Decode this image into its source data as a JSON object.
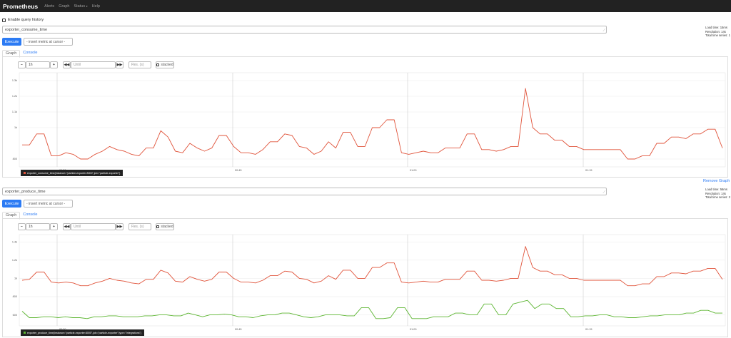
{
  "navbar": {
    "brand": "Prometheus",
    "items": [
      "Alerts",
      "Graph",
      "Status",
      "Help"
    ]
  },
  "history": {
    "label": "Enable query history"
  },
  "panels": [
    {
      "expression": "exporter_consume_time",
      "stats": {
        "load_time": "Load time: 15ms",
        "resolution": "Resolution: 14s",
        "series": "Total time series: 1"
      },
      "execute_label": "Execute",
      "insert_metric": "- insert metric at cursor -",
      "tabs": [
        "Graph",
        "Console"
      ],
      "controls": {
        "minus": "−",
        "range": "1h",
        "plus": "+",
        "back": "◀◀",
        "until_placeholder": "Until",
        "forward": "▶▶",
        "res_placeholder": "Res. (s)",
        "stacked": "stacked"
      },
      "legend": [
        "exporter_consume_time{instance=\"particle-exporter:8000\",job=\"particle-exporter\"}"
      ],
      "remove_label": "Remove Graph"
    },
    {
      "expression": "exporter_produce_time",
      "stats": {
        "load_time": "Load time: 56ms",
        "resolution": "Resolution: 14s",
        "series": "Total time series: 2"
      },
      "execute_label": "Execute",
      "insert_metric": "- insert metric at cursor -",
      "tabs": [
        "Graph",
        "Console"
      ],
      "controls": {
        "minus": "−",
        "range": "1h",
        "plus": "+",
        "back": "◀◀",
        "until_placeholder": "Until",
        "forward": "▶▶",
        "res_placeholder": "Res. (s)",
        "stacked": "stacked"
      },
      "legend": [
        "exporter_produce_time{instance=\"particle-exporter:8000\",job=\"particle-exporter\",type=\"Integrations\"}"
      ]
    }
  ],
  "chart_data": [
    {
      "type": "line",
      "y_ticks": [
        "800",
        "1k",
        "1.1k",
        "1.2k",
        "1.3k"
      ],
      "x_ticks": [
        "00:30",
        "00:45",
        "01:00",
        "01:15"
      ],
      "ylim": [
        750,
        1350
      ],
      "grid": true,
      "series": [
        {
          "color": "#e0533a",
          "values": [
            890,
            890,
            960,
            960,
            820,
            820,
            840,
            830,
            800,
            800,
            830,
            850,
            880,
            860,
            850,
            830,
            820,
            870,
            870,
            980,
            940,
            850,
            840,
            900,
            870,
            850,
            870,
            950,
            950,
            880,
            840,
            840,
            830,
            860,
            910,
            910,
            960,
            950,
            880,
            870,
            830,
            850,
            910,
            870,
            970,
            970,
            880,
            880,
            1000,
            1000,
            1050,
            1050,
            840,
            830,
            840,
            850,
            840,
            840,
            870,
            870,
            870,
            960,
            960,
            860,
            860,
            850,
            860,
            880,
            880,
            1250,
            1000,
            960,
            960,
            920,
            920,
            880,
            880,
            860,
            860,
            860,
            860,
            860,
            860,
            800,
            800,
            820,
            820,
            900,
            900,
            940,
            940,
            930,
            960,
            960,
            990,
            990,
            870
          ]
        }
      ]
    },
    {
      "type": "line",
      "y_ticks": [
        "600",
        "800",
        "1k",
        "1.2k",
        "1.4k"
      ],
      "x_ticks": [
        "00:30",
        "00:45",
        "01:00",
        "01:15"
      ],
      "ylim": [
        480,
        1480
      ],
      "grid": true,
      "series": [
        {
          "color": "#e0533a",
          "values": [
            980,
            990,
            1070,
            1070,
            960,
            950,
            960,
            950,
            920,
            920,
            950,
            970,
            1000,
            980,
            970,
            950,
            940,
            990,
            990,
            1090,
            1060,
            970,
            960,
            1020,
            990,
            970,
            990,
            1070,
            1070,
            1000,
            960,
            960,
            950,
            980,
            1030,
            1030,
            1080,
            1070,
            1000,
            990,
            950,
            970,
            1030,
            990,
            1090,
            1090,
            1000,
            1000,
            1120,
            1120,
            1170,
            1170,
            960,
            950,
            960,
            970,
            960,
            960,
            990,
            990,
            990,
            1080,
            1080,
            980,
            980,
            970,
            980,
            1000,
            1000,
            1350,
            1120,
            1080,
            1080,
            1040,
            1040,
            1000,
            1000,
            980,
            980,
            980,
            980,
            980,
            980,
            920,
            920,
            940,
            940,
            1020,
            1020,
            1060,
            1060,
            1050,
            1080,
            1080,
            1110,
            1110,
            990
          ]
        },
        {
          "color": "#5cb531",
          "values": [
            640,
            570,
            570,
            580,
            580,
            570,
            580,
            570,
            570,
            560,
            580,
            580,
            590,
            590,
            580,
            580,
            580,
            590,
            590,
            600,
            600,
            590,
            590,
            620,
            600,
            580,
            600,
            600,
            610,
            600,
            580,
            580,
            570,
            590,
            600,
            600,
            620,
            620,
            600,
            580,
            570,
            580,
            600,
            600,
            600,
            590,
            590,
            680,
            680,
            560,
            560,
            570,
            680,
            680,
            560,
            560,
            560,
            580,
            580,
            580,
            620,
            620,
            600,
            600,
            720,
            720,
            600,
            600,
            720,
            740,
            760,
            670,
            720,
            720,
            670,
            670,
            580,
            580,
            590,
            590,
            600,
            600,
            580,
            580,
            570,
            570,
            580,
            590,
            590,
            600,
            600,
            600,
            620,
            620,
            650,
            650,
            620,
            620
          ]
        }
      ]
    }
  ]
}
